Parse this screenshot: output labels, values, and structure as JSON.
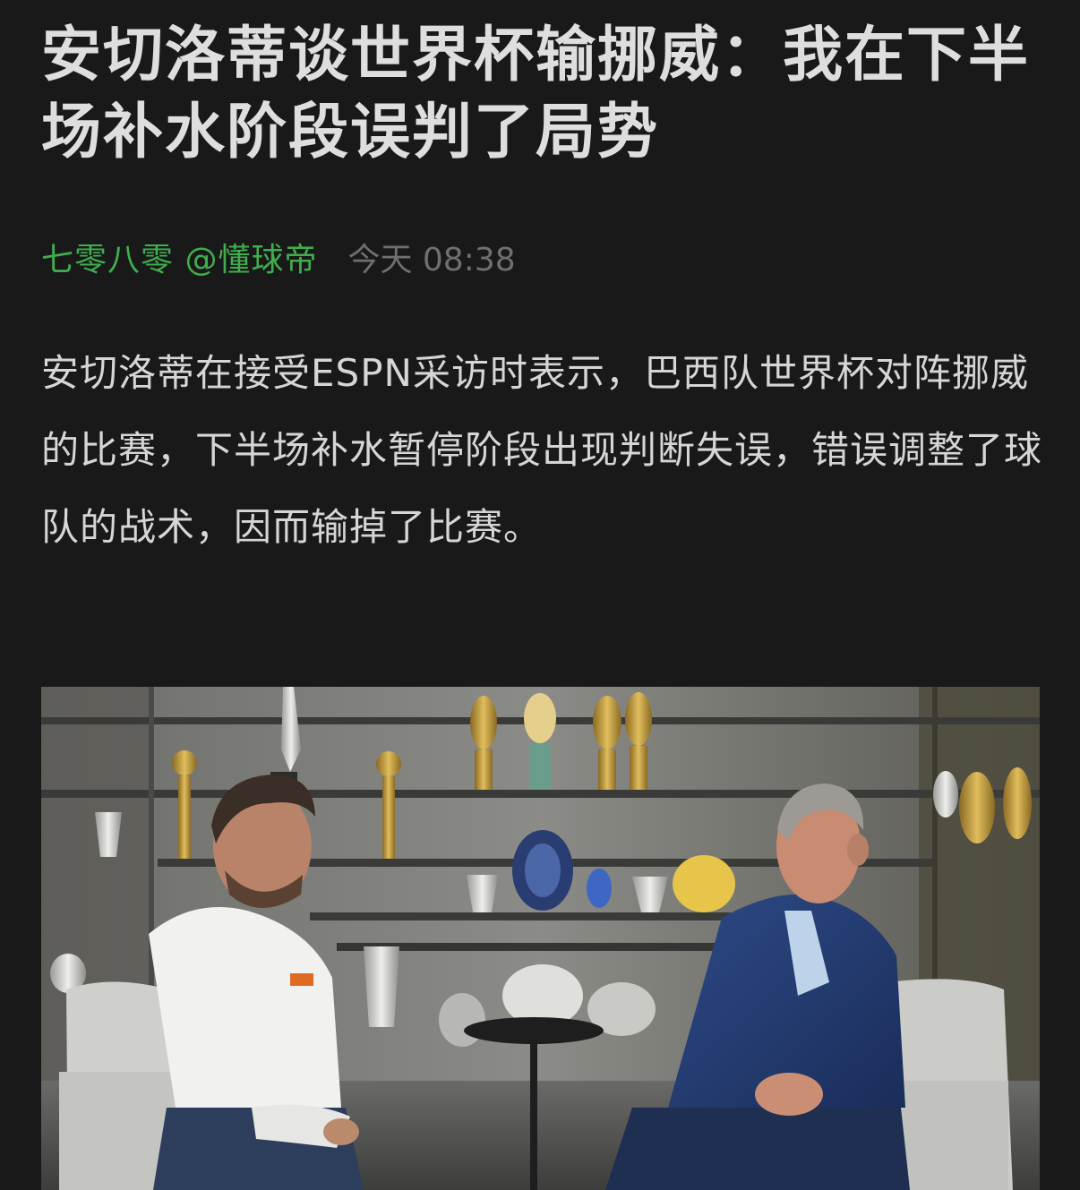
{
  "article": {
    "title": "安切洛蒂谈世界杯输挪威：我在下半场补水阶段误判了局势",
    "author": "七零八零 @懂球帝",
    "time": "今天 08:38",
    "body": "安切洛蒂在接受ESPN采访时表示，巴西队世界杯对阵挪威的比赛，下半场补水暂停阶段出现判断失误，错误调整了球队的战术，因而输掉了比赛。"
  },
  "colors": {
    "background": "#191919",
    "title": "#dedede",
    "author": "#3fae4e",
    "time": "#6f6f6f",
    "body": "#d6d6d6"
  }
}
